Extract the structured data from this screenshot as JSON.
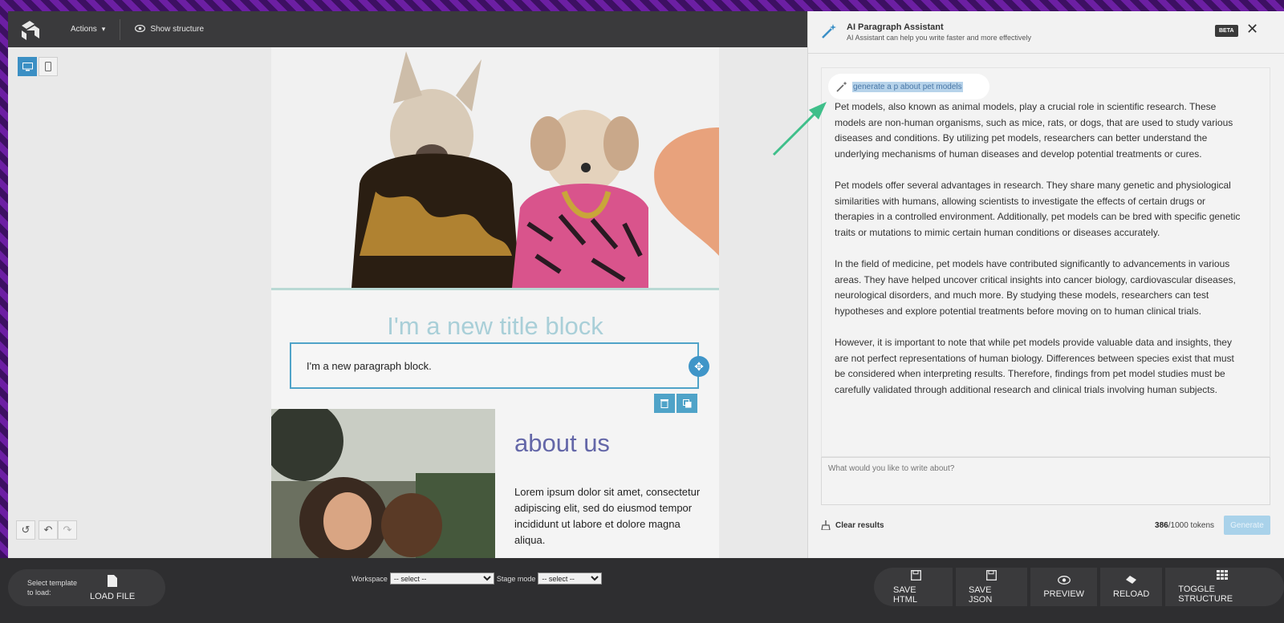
{
  "editor": {
    "topbar": {
      "actions_label": "Actions",
      "show_structure_label": "Show structure"
    },
    "title_block_text": "I'm a new title block",
    "paragraph_block_text": "I'm a new paragraph block.",
    "about": {
      "title": "about us",
      "text": "Lorem ipsum dolor sit amet, consectetur adipiscing elit, sed do eiusmod tempor incididunt ut labore et dolore magna aliqua."
    }
  },
  "ai_panel": {
    "title": "AI Paragraph Assistant",
    "subtitle": "AI Assistant can help you write faster and more effectively",
    "beta_badge": "BETA",
    "prompt": "generate a p about pet models",
    "result": [
      "Pet models, also known as animal models, play a crucial role in scientific research. These models are non-human organisms, such as mice, rats, or dogs, that are used to study various diseases and conditions. By utilizing pet models, researchers can better understand the underlying mechanisms of human diseases and develop potential treatments or cures.",
      "Pet models offer several advantages in research. They share many genetic and physiological similarities with humans, allowing scientists to investigate the effects of certain drugs or therapies in a controlled environment. Additionally, pet models can be bred with specific genetic traits or mutations to mimic certain human conditions or diseases accurately.",
      "In the field of medicine, pet models have contributed significantly to advancements in various areas. They have helped uncover critical insights into cancer biology, cardiovascular diseases, neurological disorders, and much more. By studying these models, researchers can test hypotheses and explore potential treatments before moving on to human clinical trials.",
      "However, it is important to note that while pet models provide valuable data and insights, they are not perfect representations of human biology. Differences between species exist that must be considered when interpreting results. Therefore, findings from pet model studies must be carefully validated through additional research and clinical trials involving human subjects."
    ],
    "input_placeholder": "What would you like to write about?",
    "clear_label": "Clear results",
    "tokens_used": "386",
    "tokens_total": "/1000 tokens",
    "generate_label": "Generate"
  },
  "bottombar": {
    "template_label": "Select template to load:",
    "load_file": "LOAD FILE",
    "workspace_label": "Workspace",
    "workspace_value": "-- select --",
    "stage_mode_label": "Stage mode",
    "stage_mode_value": "-- select --",
    "buttons": [
      "SAVE HTML",
      "SAVE JSON",
      "PREVIEW",
      "RELOAD",
      "TOGGLE STRUCTURE"
    ]
  },
  "colors": {
    "frame_purple": "#6c1fa3",
    "accent_blue": "#4fa3c8",
    "arrow_green": "#3fbf8a"
  }
}
